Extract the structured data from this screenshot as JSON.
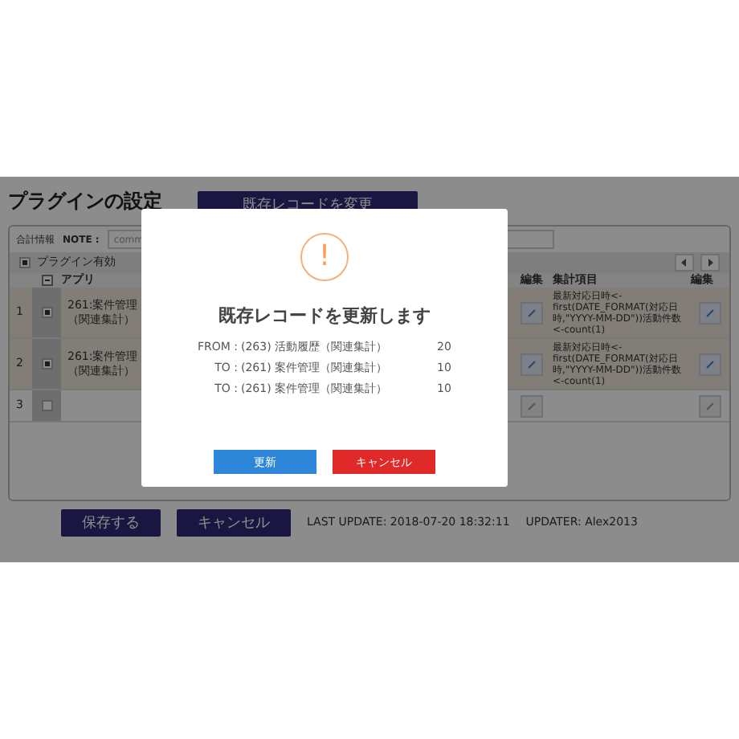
{
  "page": {
    "title": "プラグインの設定",
    "update_button": "既存レコードを変更",
    "summary_label": "合計情報",
    "note_label": "NOTE :",
    "note_value": "comm",
    "enabled": {
      "label": "プラグイン有効",
      "checked": true
    },
    "select_all": {
      "indeterminate": true
    },
    "columns": {
      "app": "アプリ",
      "edit": "編集",
      "items": "集計項目",
      "edit_2": "編集"
    },
    "rows": [
      {
        "number": "1",
        "checked": true,
        "app": "261:案件管理（関連集計）",
        "items": "最新対応日時<-first(DATE_FORMAT(対応日時,\"YYYY-MM-DD\"))活動件数<-count(1)"
      },
      {
        "number": "2",
        "checked": true,
        "app": "261:案件管理（関連集計）",
        "items": "最新対応日時<-first(DATE_FORMAT(対応日時,\"YYYY-MM-DD\"))活動件数<-count(1)"
      },
      {
        "number": "3",
        "checked": false,
        "app": "",
        "items": ""
      }
    ],
    "save_button": "保存する",
    "cancel_button": "キャンセル",
    "last_update": "LAST UPDATE: 2018-07-20 18:32:11",
    "updater": "UPDATER: Alex2013"
  },
  "dialog": {
    "icon": "!",
    "title": "既存レコードを更新します",
    "rows": [
      {
        "label": "FROM :",
        "value": "(263) 活動履歴（関連集計）",
        "count": "20"
      },
      {
        "label": "TO :",
        "value": "(261) 案件管理（関連集計）",
        "count": "10"
      },
      {
        "label": "TO :",
        "value": "(261) 案件管理（関連集計）",
        "count": "10"
      }
    ],
    "confirm_button": "更新",
    "cancel_button": "キャンセル"
  }
}
